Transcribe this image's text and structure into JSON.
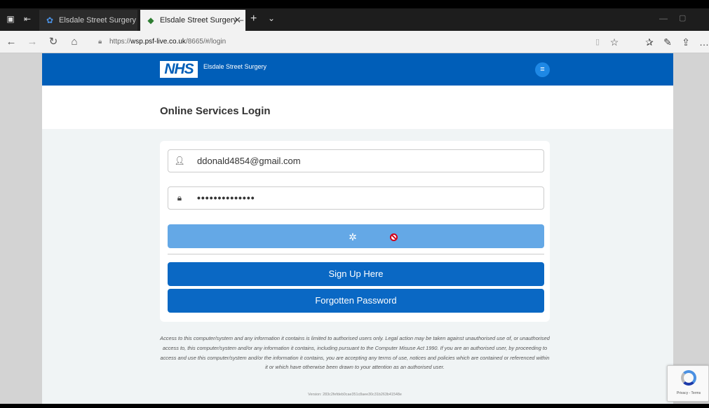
{
  "browser": {
    "tabs": [
      {
        "title": "Elsdale Street Surgery",
        "active": false
      },
      {
        "title": "Elsdale Street Surgery – ",
        "active": true
      }
    ],
    "new_tab_symbol": "+",
    "url_prefix": "https://",
    "url_host": "wsp.psf-live.co.uk",
    "url_path": "/8665/#/login"
  },
  "header": {
    "logo_text": "NHS",
    "practice_name": "Elsdale Street Surgery",
    "brand_color": "#005eb8"
  },
  "page": {
    "title": "Online Services Login"
  },
  "form": {
    "username_value": "ddonald4854@gmail.com",
    "password_value": "••••••••••••••",
    "login_state": "loading",
    "signup_label": "Sign Up Here",
    "forgot_label": "Forgotten Password"
  },
  "legal": {
    "text": "Access to this computer/system and any information it contains is limited to authorised users only. Legal action may be taken against unauthorised use of, or unauthorised access to, this computer/system and/or any information it contains, including pursuant to the Computer Misuse Act 1990. If you are an authorised user, by proceeding to access and use this computer/system and/or the information it contains, you are accepting any terms of use, notices and policies which are contained or referenced within it or which have otherwise been drawn to your attention as an authorised user.",
    "version": "Version: 283c2fefdeb0cae351c8aee30c31b263b41548e"
  },
  "recaptcha": {
    "label": "Privacy - Terms"
  },
  "icons": {
    "user": "user-icon",
    "lock": "lock-icon",
    "spinner": "loading-spinner-icon",
    "blocked_cursor": "no-entry-cursor-icon"
  }
}
